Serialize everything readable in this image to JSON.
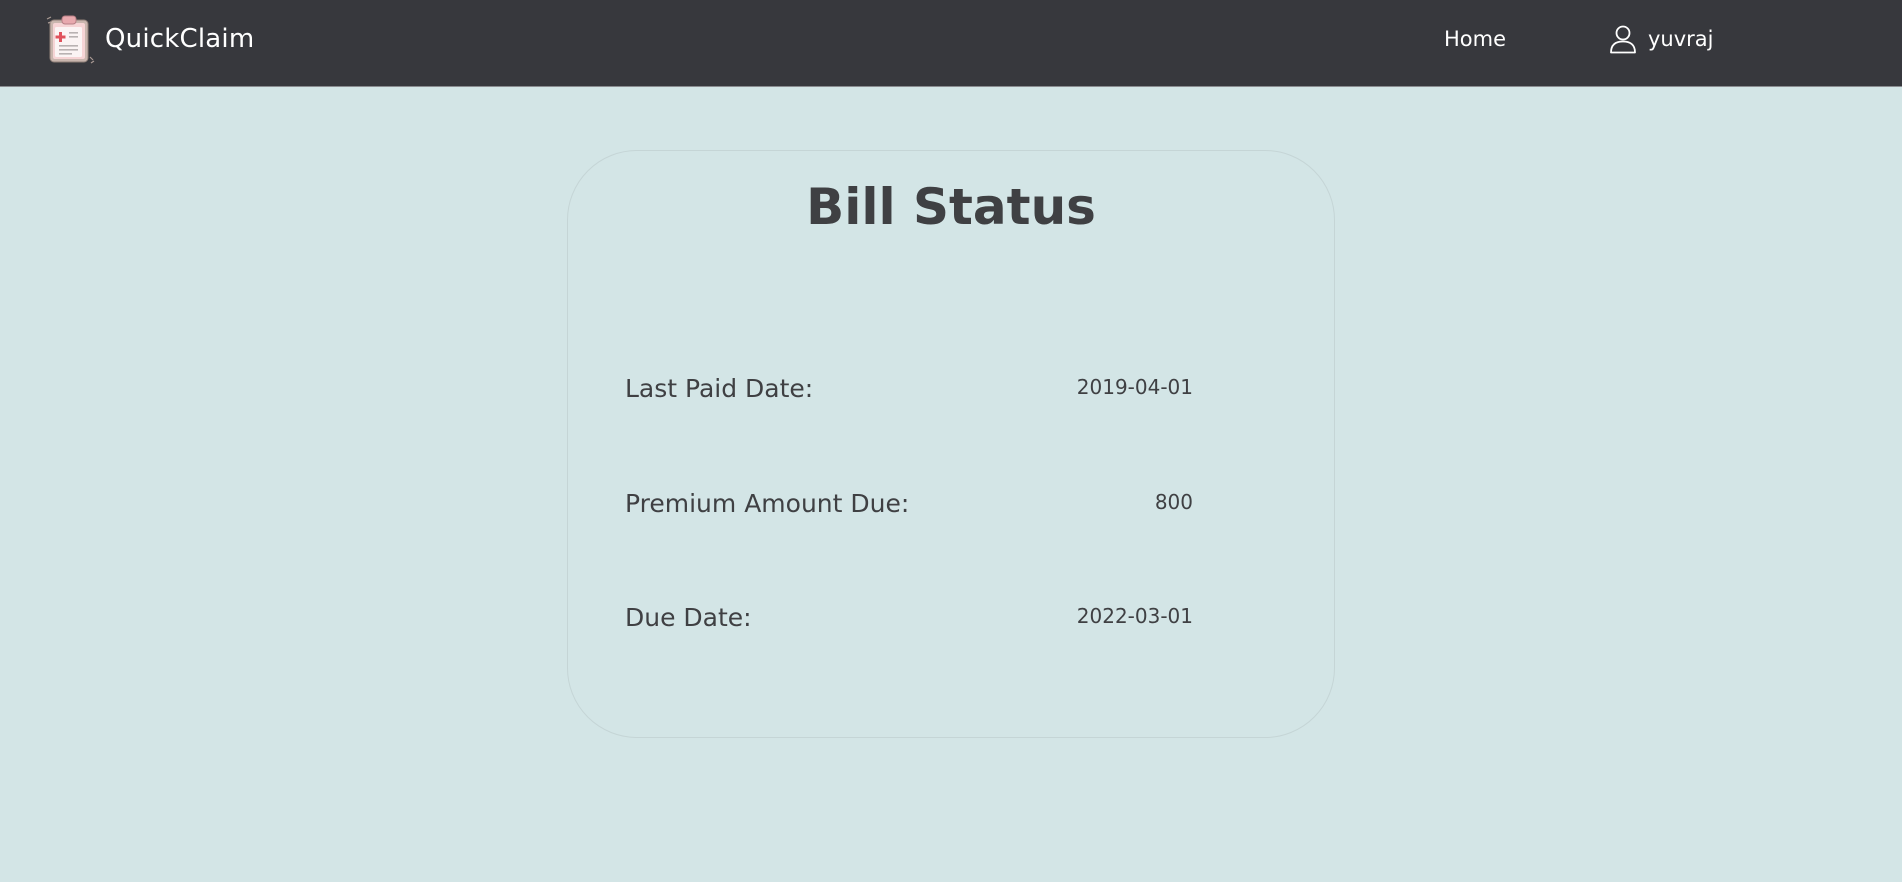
{
  "header": {
    "brand_name": "QuickClaim",
    "brand_icon": "medical-clipboard-icon",
    "nav_home_label": "Home",
    "user_icon": "user-icon",
    "username": "yuvraj"
  },
  "bill": {
    "title": "Bill Status",
    "rows": [
      {
        "label": "Last Paid Date:",
        "value": "2019-04-01"
      },
      {
        "label": "Premium Amount Due:",
        "value": "800"
      },
      {
        "label": "Due Date:",
        "value": "2022-03-01"
      }
    ]
  },
  "colors": {
    "header_bg": "#37383d",
    "page_bg": "#d3e5e6",
    "text": "#3f4043",
    "logo_pink": "#f2c4c6",
    "logo_cross": "#e0525c"
  }
}
